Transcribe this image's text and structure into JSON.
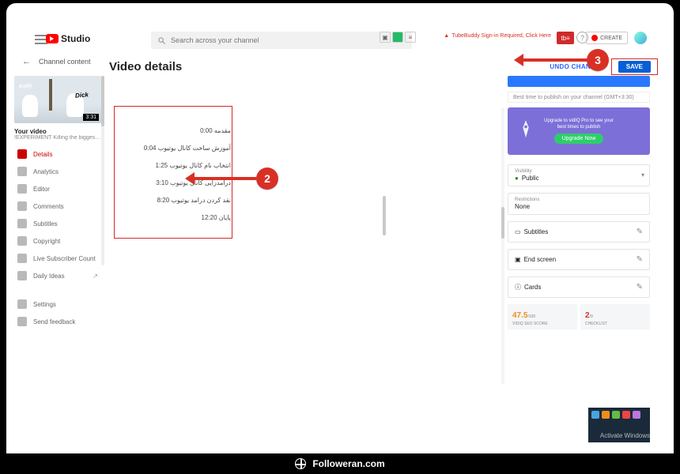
{
  "brand": {
    "name": "Studio"
  },
  "header": {
    "search_placeholder": "Search across your channel",
    "tubebuddy_warning": "TubeBuddy Sign-in Required, Click Here",
    "create_label": "CREATE"
  },
  "back_row": {
    "label": "Channel content"
  },
  "page": {
    "title": "Video details",
    "undo_label": "UNDO CHANGES",
    "save_label": "SAVE"
  },
  "video": {
    "thumb_label_1": "Kelly",
    "thumb_label_2": "Dick",
    "duration": "3:31",
    "heading": "Your video",
    "subtitle": "!EXPERIMENT Killing the biggest sn..."
  },
  "sidebar": {
    "items": [
      {
        "label": "Details"
      },
      {
        "label": "Analytics"
      },
      {
        "label": "Editor"
      },
      {
        "label": "Comments"
      },
      {
        "label": "Subtitles"
      },
      {
        "label": "Copyright"
      },
      {
        "label": "Live Subscriber Count"
      },
      {
        "label": "Daily Ideas"
      }
    ],
    "footer": [
      {
        "label": "Settings"
      },
      {
        "label": "Send feedback"
      }
    ]
  },
  "chapters": [
    "مقدمه 0:00",
    "آموزش ساخت کانال یوتیوب 0:04",
    "انتخاب نام کانال یوتیوب 1:25",
    "درآمدزایی کانال یوتیوب 3:10",
    "نقد کردن درامد یوتیوب 8:20",
    "پایان 12:20"
  ],
  "right": {
    "best_time": "Best time to publish on your channel (GMT+3:30)",
    "promo_text": "Upgrade to vidIQ Pro to see your best times to publish",
    "promo_btn": "Upgrade Now",
    "visibility_label": "Visibility",
    "visibility_value": "Public",
    "restrictions_label": "Restrictions",
    "restrictions_value": "None",
    "subtitles_label": "Subtitles",
    "endscreen_label": "End screen",
    "cards_label": "Cards",
    "score1_value": "47.5",
    "score1_max": "/100",
    "score1_label": "VIDIQ SEO SCORE",
    "score2_value": "2",
    "score2_max": "/9",
    "score2_label": "CHECKLIST"
  },
  "watermark": {
    "line1": "Activate Windows"
  },
  "annotations": {
    "n2": "2",
    "n3": "3"
  },
  "footer": {
    "text": "Followeran.com"
  }
}
